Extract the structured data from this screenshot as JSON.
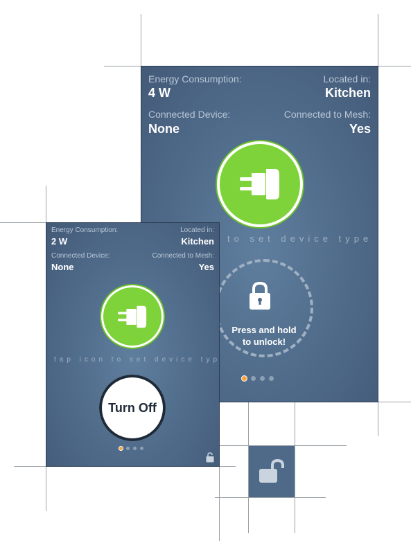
{
  "colors": {
    "panel": "#4f6a89",
    "accent_green": "#7ed23a",
    "page_dot_active": "#f7a23b",
    "page_dot": "#8da0b4",
    "label": "#b9c7d6"
  },
  "large_panel": {
    "energy_label": "Energy Consumption:",
    "energy_value": "4 W",
    "location_label": "Located in:",
    "location_value": "Kitchen",
    "device_label": "Connected Device:",
    "device_value": "None",
    "mesh_label": "Connected to Mesh:",
    "mesh_value": "Yes",
    "hint": "to set device type",
    "unlock_text_line1": "Press and hold",
    "unlock_text_line2": "to unlock!",
    "plug_icon": "plug-icon",
    "lock_icon": "lock-icon",
    "page_count": 4,
    "active_page": 1
  },
  "small_panel": {
    "energy_label": "Energy Consumption:",
    "energy_value": "2 W",
    "location_label": "Located in:",
    "location_value": "Kitchen",
    "device_label": "Connected Device:",
    "device_value": "None",
    "mesh_label": "Connected to Mesh:",
    "mesh_value": "Yes",
    "hint": "tap icon to set device type",
    "button_label": "Turn Off",
    "plug_icon": "plug-icon",
    "corner_icon": "lock-open-icon",
    "page_count": 4,
    "active_page": 1
  },
  "standalone_icon": "lock-open-icon"
}
